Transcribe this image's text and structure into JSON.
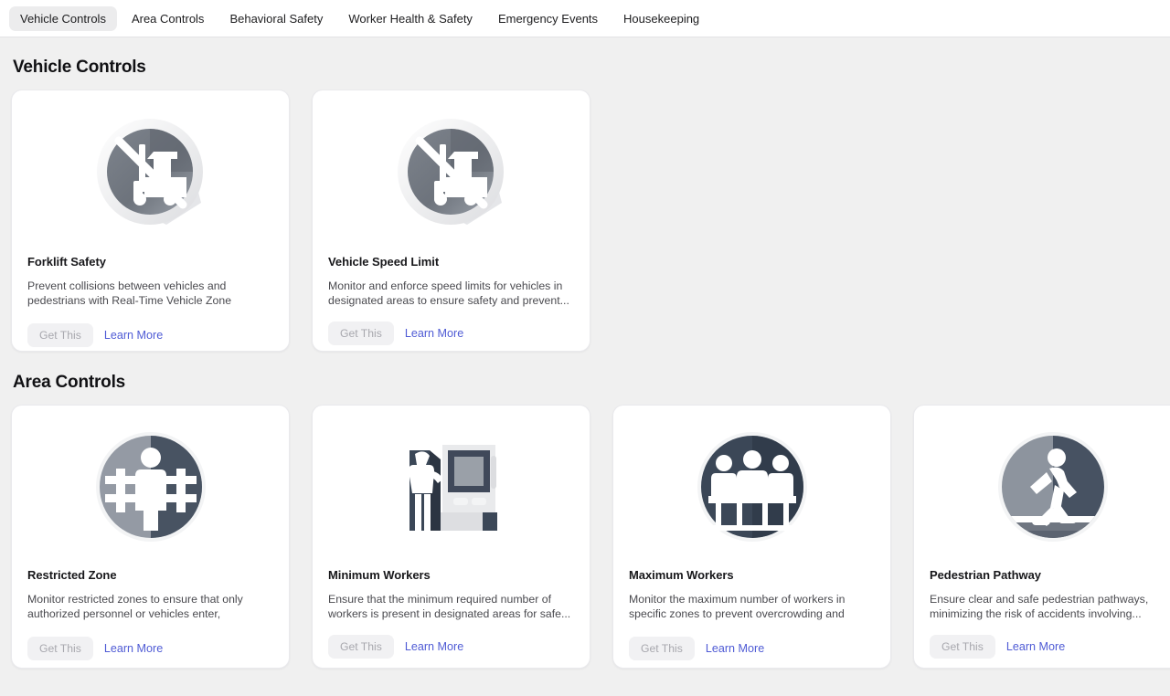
{
  "tabs": [
    {
      "label": "Vehicle Controls",
      "active": true
    },
    {
      "label": "Area Controls",
      "active": false
    },
    {
      "label": "Behavioral Safety",
      "active": false
    },
    {
      "label": "Worker Health & Safety",
      "active": false
    },
    {
      "label": "Emergency Events",
      "active": false
    },
    {
      "label": "Housekeeping",
      "active": false
    }
  ],
  "colors": {
    "page_background": "#f0f0f0",
    "card_background": "#ffffff",
    "active_tab_background": "#ececed",
    "link": "#4f5bd5",
    "disabled_button_text": "#a8a8ae",
    "disabled_button_background": "#f1f1f3",
    "icon_dark": "#3c4a5a",
    "icon_gray": "#8a919c"
  },
  "buttons": {
    "get_this": "Get This",
    "learn_more": "Learn More"
  },
  "sections": [
    {
      "title": "Vehicle Controls",
      "cards": [
        {
          "icon": "no-forklift-badge-icon",
          "title": "Forklift Safety",
          "description": "Prevent collisions between vehicles and pedestrians with Real-Time Vehicle Zone Monitoring. Actively...",
          "get_this": "Get This",
          "learn_more": "Learn More"
        },
        {
          "icon": "no-forklift-badge-icon",
          "title": "Vehicle Speed Limit",
          "description": "Monitor and enforce speed limits for vehicles in designated areas to ensure safety and prevent...",
          "get_this": "Get This",
          "learn_more": "Learn More"
        }
      ]
    },
    {
      "title": "Area Controls",
      "cards": [
        {
          "icon": "person-behind-fence-icon",
          "title": "Restricted Zone",
          "description": "Monitor restricted zones to ensure that only authorized personnel or vehicles enter, enhancing...",
          "get_this": "Get This",
          "learn_more": "Learn More"
        },
        {
          "icon": "worker-at-machine-icon",
          "title": "Minimum Workers",
          "description": "Ensure that the minimum required number of workers is present in designated areas for safe...",
          "get_this": "Get This",
          "learn_more": "Learn More"
        },
        {
          "icon": "three-workers-at-railing-icon",
          "title": "Maximum Workers",
          "description": "Monitor the maximum number of workers in specific zones to prevent overcrowding and ensure...",
          "get_this": "Get This",
          "learn_more": "Learn More"
        },
        {
          "icon": "walking-pedestrian-icon",
          "title": "Pedestrian Pathway",
          "description": "Ensure clear and safe pedestrian pathways, minimizing the risk of accidents involving...",
          "get_this": "Get This",
          "learn_more": "Learn More"
        }
      ]
    }
  ]
}
